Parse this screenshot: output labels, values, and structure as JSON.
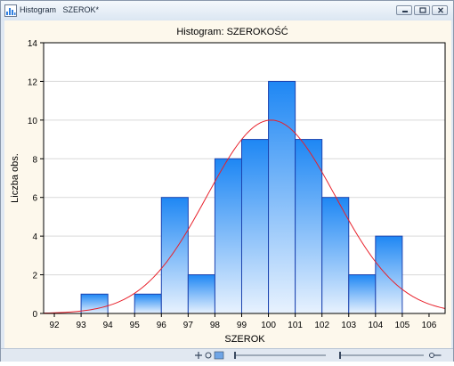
{
  "window": {
    "title": "Histogram   SZEROK*",
    "app_icon": "histogram-icon"
  },
  "controls": {
    "minimize_icon": "minimize-icon",
    "maximize_icon": "maximize-icon",
    "close_icon": "close-icon"
  },
  "statusbar": {
    "icons": [
      "pan-icon",
      "zoom-icon",
      "slider-icon",
      "slider-icon",
      "key-icon"
    ]
  },
  "colors": {
    "bar_top": "#1e87f4",
    "bar_bottom": "#e8f2fe",
    "bar_edge": "#1d44b0",
    "curve": "#e8202a",
    "plot_bg": "#fdf8ec"
  },
  "chart_data": {
    "type": "bar",
    "title": "Histogram: SZEROKOŚĆ",
    "xlabel": "SZEROK",
    "ylabel": "Liczba obs.",
    "categories": [
      "93-94",
      "94-95",
      "95-96",
      "96-97",
      "97-98",
      "98-99",
      "99-100",
      "100-101",
      "101-102",
      "102-103",
      "103-104",
      "104-105"
    ],
    "bin_edges": [
      93,
      94,
      95,
      96,
      97,
      98,
      99,
      100,
      101,
      102,
      103,
      104,
      105
    ],
    "values": [
      1,
      0,
      1,
      6,
      2,
      8,
      9,
      12,
      9,
      6,
      2,
      4
    ],
    "xlim": [
      91.6,
      106.6
    ],
    "ylim": [
      0,
      14
    ],
    "x_ticks": [
      "92",
      "93",
      "94",
      "95",
      "96",
      "97",
      "98",
      "99",
      "100",
      "101",
      "102",
      "103",
      "104",
      "105",
      "106"
    ],
    "y_ticks": [
      "0",
      "2",
      "4",
      "6",
      "8",
      "10",
      "12",
      "14"
    ],
    "grid": true,
    "normal_curve": {
      "mean": 100.1,
      "sd": 2.4,
      "peak": 10
    }
  }
}
